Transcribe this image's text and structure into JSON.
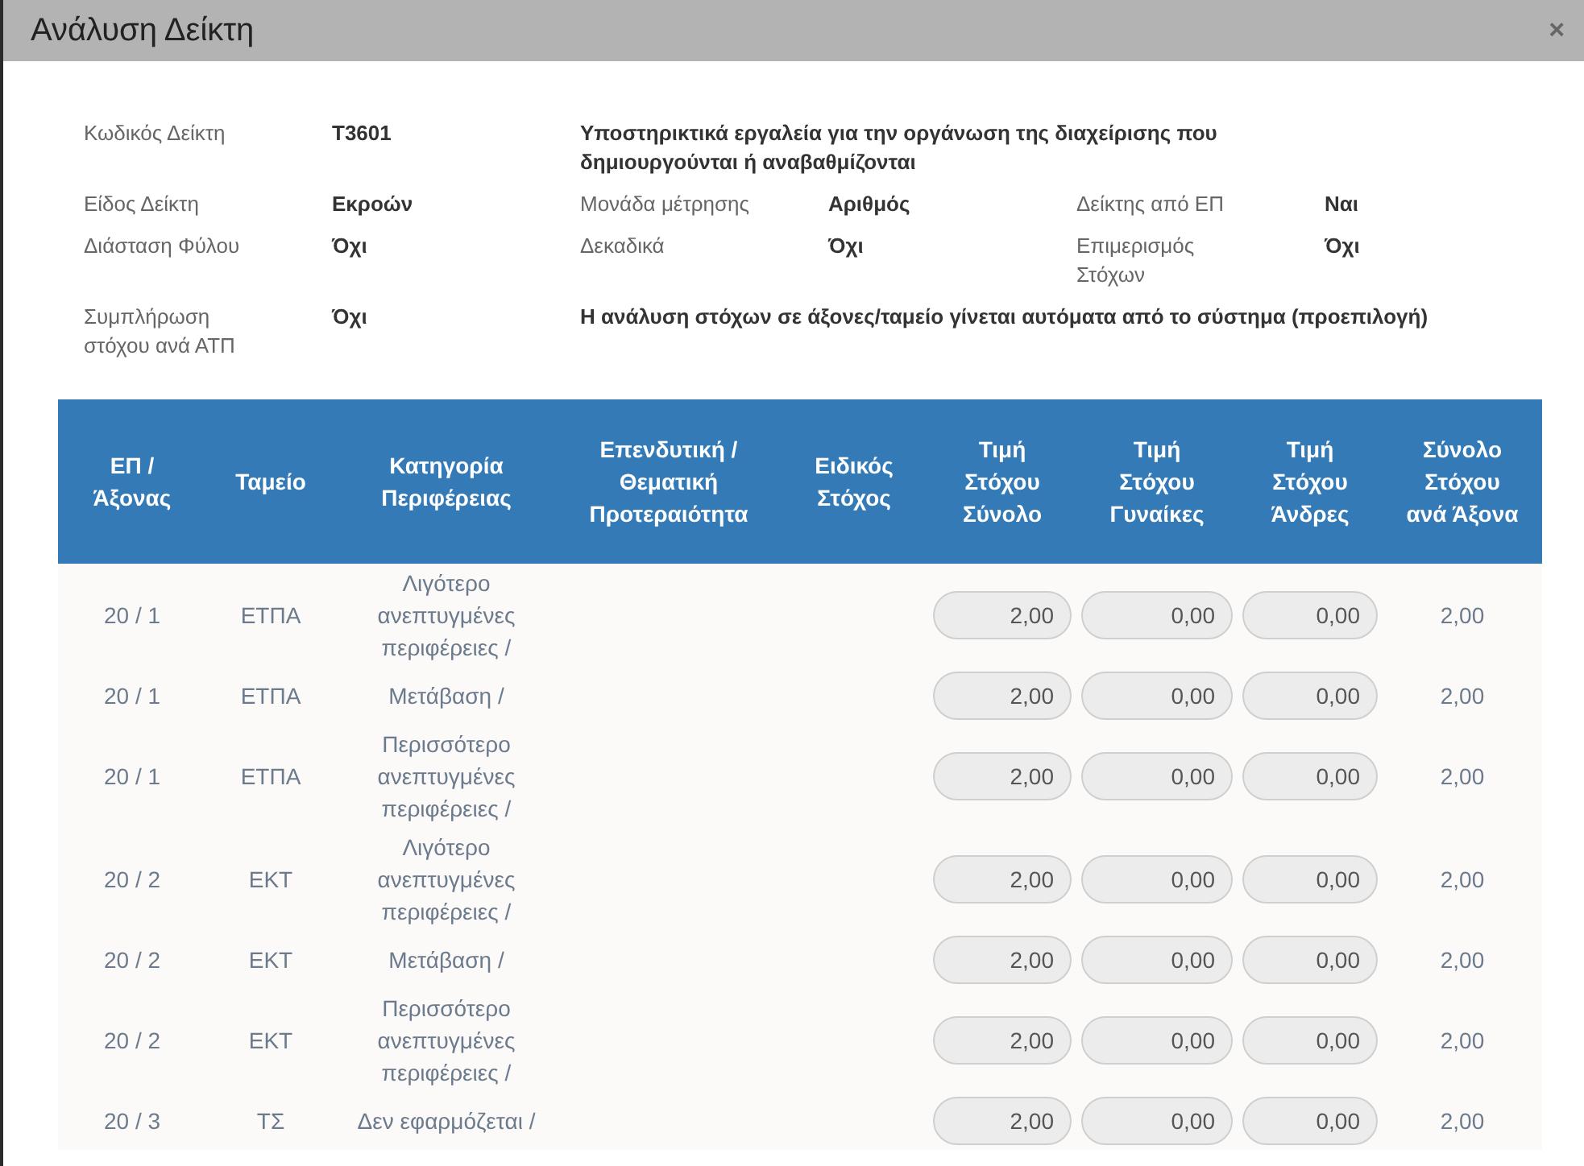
{
  "dialog": {
    "title": "Ανάλυση Δείκτη",
    "close": "×"
  },
  "details": [
    {
      "cells": [
        {
          "kind": "label",
          "text": "Κωδικός Δείκτη"
        },
        {
          "kind": "value",
          "text": "T3601"
        },
        {
          "kind": "description",
          "text": "Υποστηρικτικά εργαλεία για την οργάνωση της διαχείρισης που δημιουργούνται ή αναβαθμίζονται"
        }
      ]
    },
    {
      "cells": [
        {
          "kind": "label",
          "text": "Είδος Δείκτη"
        },
        {
          "kind": "value",
          "text": "Εκροών"
        },
        {
          "kind": "label",
          "text": "Μονάδα μέτρησης"
        },
        {
          "kind": "value",
          "text": "Αριθμός"
        },
        {
          "kind": "label",
          "text": "Δείκτης από ΕΠ"
        },
        {
          "kind": "value",
          "text": "Ναι"
        }
      ]
    },
    {
      "cells": [
        {
          "kind": "label",
          "text": "Διάσταση Φύλου"
        },
        {
          "kind": "value",
          "text": "Όχι"
        },
        {
          "kind": "label",
          "text": "Δεκαδικά"
        },
        {
          "kind": "value",
          "text": "Όχι"
        },
        {
          "kind": "label",
          "text": "Επιμερισμός Στόχων"
        },
        {
          "kind": "value",
          "text": "Όχι"
        }
      ]
    },
    {
      "cells": [
        {
          "kind": "label",
          "text": "Συμπλήρωση στόχου ανά ΑΤΠ"
        },
        {
          "kind": "value",
          "text": "Όχι"
        },
        {
          "kind": "remark",
          "text": "Η ανάλυση στόχων σε άξονες/ταμείο γίνεται αυτόματα από το σύστημα (προεπιλογή)"
        }
      ]
    }
  ],
  "table": {
    "columns": [
      "ΕΠ / Άξονας",
      "Ταμείο",
      "Κατηγορία Περιφέρειας",
      "Επενδυτική / Θεματική Προτεραιότητα",
      "Ειδικός Στόχος",
      "Τιμή Στόχου Σύνολο",
      "Τιμή Στόχου Γυναίκες",
      "Τιμή Στόχου Άνδρες",
      "Σύνολο Στόχου ανά Άξονα"
    ],
    "rows": [
      {
        "axis": "20 / 1",
        "fund": "ΕΤΠΑ",
        "category": "Λιγότερο ανεπτυγμένες περιφέρειες /",
        "total": "2,00",
        "women": "0,00",
        "men": "0,00",
        "axis_total": "2,00"
      },
      {
        "axis": "20 / 1",
        "fund": "ΕΤΠΑ",
        "category": "Μετάβαση /",
        "total": "2,00",
        "women": "0,00",
        "men": "0,00",
        "axis_total": "2,00"
      },
      {
        "axis": "20 / 1",
        "fund": "ΕΤΠΑ",
        "category": "Περισσότερο ανεπτυγμένες περιφέρειες /",
        "total": "2,00",
        "women": "0,00",
        "men": "0,00",
        "axis_total": "2,00"
      },
      {
        "axis": "20 / 2",
        "fund": "ΕΚΤ",
        "category": "Λιγότερο ανεπτυγμένες περιφέρειες /",
        "total": "2,00",
        "women": "0,00",
        "men": "0,00",
        "axis_total": "2,00"
      },
      {
        "axis": "20 / 2",
        "fund": "ΕΚΤ",
        "category": "Μετάβαση /",
        "total": "2,00",
        "women": "0,00",
        "men": "0,00",
        "axis_total": "2,00"
      },
      {
        "axis": "20 / 2",
        "fund": "ΕΚΤ",
        "category": "Περισσότερο ανεπτυγμένες περιφέρειες /",
        "total": "2,00",
        "women": "0,00",
        "men": "0,00",
        "axis_total": "2,00"
      },
      {
        "axis": "20 / 3",
        "fund": "ΤΣ",
        "category": "Δεν εφαρμόζεται /",
        "total": "2,00",
        "women": "0,00",
        "men": "0,00",
        "axis_total": "2,00"
      }
    ]
  }
}
